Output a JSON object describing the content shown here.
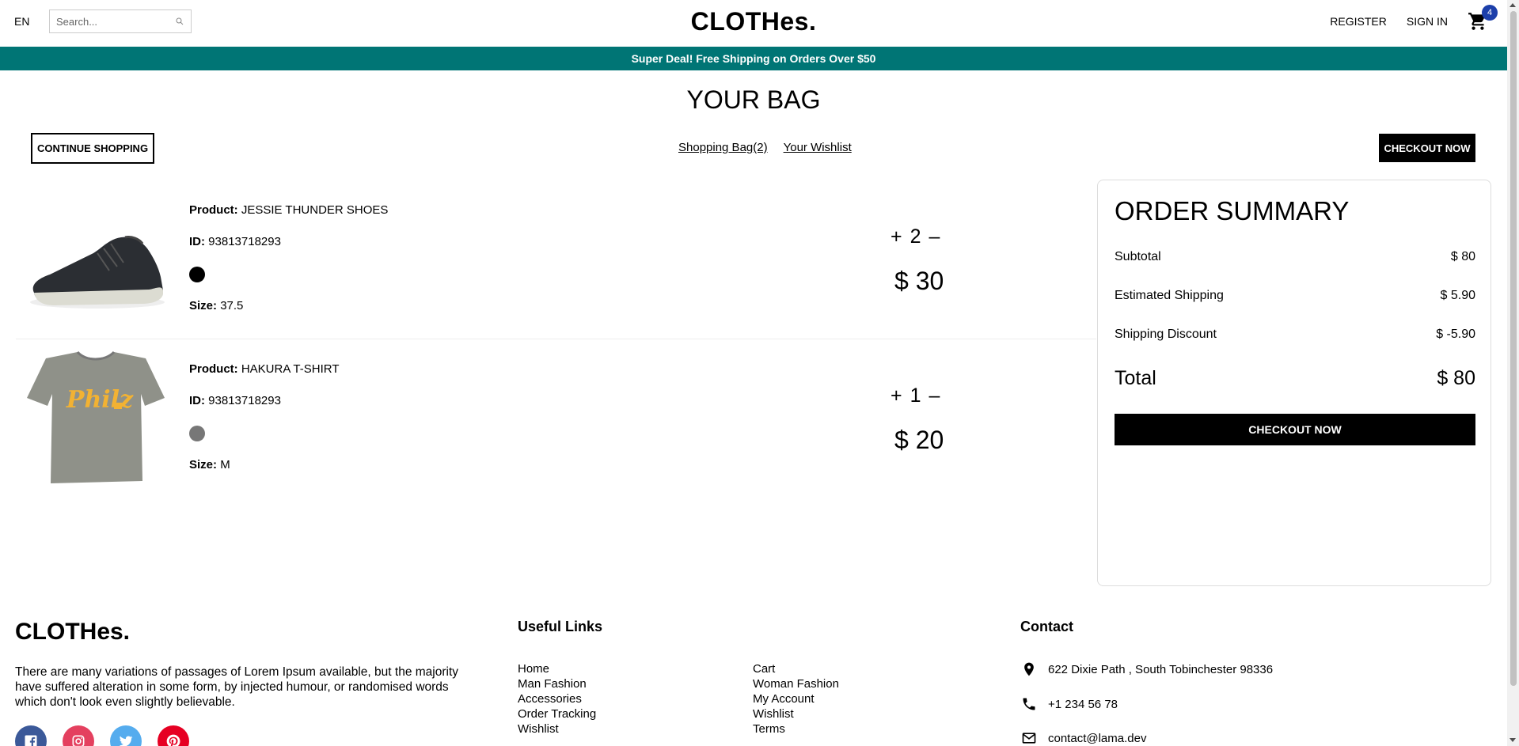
{
  "navbar": {
    "language": "EN",
    "search_placeholder": "Search...",
    "logo": "CLOTHes.",
    "register": "REGISTER",
    "sign_in": "SIGN IN",
    "cart_count": "4"
  },
  "announcement": "Super Deal! Free Shipping on Orders Over $50",
  "page_title": "YOUR BAG",
  "top_bar": {
    "continue_label": "CONTINUE SHOPPING",
    "shopping_bag_link": "Shopping Bag(2)",
    "wishlist_link": "Your Wishlist",
    "checkout_label": "CHECKOUT NOW"
  },
  "products": [
    {
      "product_label": "Product:",
      "product_name": "JESSIE THUNDER SHOES",
      "id_label": "ID:",
      "id": "93813718293",
      "color": "#000000",
      "size_label": "Size:",
      "size": "37.5",
      "quantity": "2",
      "price": "$ 30",
      "plus": "+",
      "minus": "–"
    },
    {
      "product_label": "Product:",
      "product_name": "HAKURA T-SHIRT",
      "id_label": "ID:",
      "id": "93813718293",
      "color": "#777777",
      "size_label": "Size:",
      "size": "M",
      "quantity": "1",
      "price": "$ 20",
      "plus": "+",
      "minus": "–"
    }
  ],
  "summary": {
    "title": "ORDER SUMMARY",
    "rows": [
      {
        "label": "Subtotal",
        "value": "$ 80"
      },
      {
        "label": "Estimated Shipping",
        "value": "$ 5.90"
      },
      {
        "label": "Shipping Discount",
        "value": "$ -5.90"
      }
    ],
    "total_label": "Total",
    "total_value": "$ 80",
    "checkout_label": "CHECKOUT NOW"
  },
  "footer": {
    "logo": "CLOTHes.",
    "description": "There are many variations of passages of Lorem Ipsum available, but the majority have suffered alteration in some form, by injected humour, or randomised words which don't look even slightly believable.",
    "socials": [
      {
        "icon": "facebook-icon",
        "color": "#3b5999"
      },
      {
        "icon": "instagram-icon",
        "color": "#e4405f"
      },
      {
        "icon": "twitter-icon",
        "color": "#55acee"
      },
      {
        "icon": "pinterest-icon",
        "color": "#e60023"
      }
    ],
    "useful_links_title": "Useful Links",
    "links_col1": [
      "Home",
      "Man Fashion",
      "Accessories",
      "Order Tracking",
      "Wishlist"
    ],
    "links_col2": [
      "Cart",
      "Woman Fashion",
      "My Account",
      "Wishlist",
      "Terms"
    ],
    "contact_title": "Contact",
    "address": "622 Dixie Path , South Tobinchester 98336",
    "phone": "+1 234 56 78",
    "email": "contact@lama.dev"
  },
  "colors": {
    "announcement_bg": "#007575",
    "cart_badge": "#1c3faa",
    "button_dark": "#000000"
  }
}
